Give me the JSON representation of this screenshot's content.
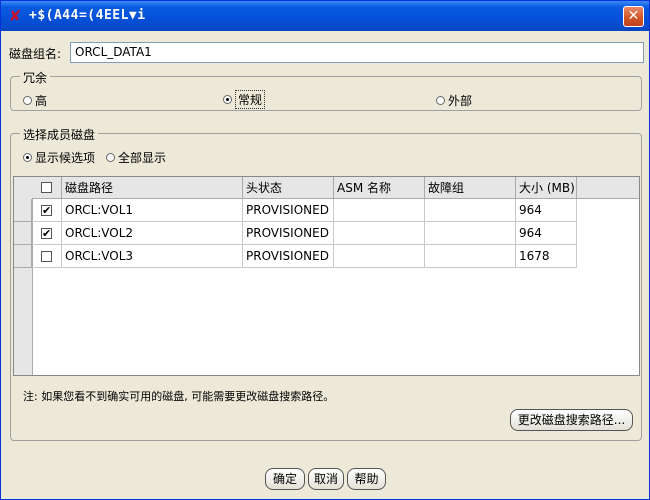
{
  "window": {
    "title": "+$(A44=(4EEL▼i",
    "title_icon": "✘",
    "close_glyph": "✕"
  },
  "diskgroup": {
    "name_label": "磁盘组名:",
    "name_value": "ORCL_DATA1"
  },
  "redundancy": {
    "title": "冗余",
    "options": [
      "高",
      "常规",
      "外部"
    ],
    "selected": "常规"
  },
  "members": {
    "title": "选择成员磁盘",
    "filter_options": [
      "显示候选项",
      "全部显示"
    ],
    "filter_selected": "显示候选项",
    "columns": [
      "磁盘路径",
      "头状态",
      "ASM 名称",
      "故障组",
      "大小 (MB)"
    ],
    "rows": [
      {
        "checked": true,
        "path": "ORCL:VOL1",
        "header_status": "PROVISIONED",
        "asm_name": "",
        "failgroup": "",
        "size": "964"
      },
      {
        "checked": true,
        "path": "ORCL:VOL2",
        "header_status": "PROVISIONED",
        "asm_name": "",
        "failgroup": "",
        "size": "964"
      },
      {
        "checked": false,
        "path": "ORCL:VOL3",
        "header_status": "PROVISIONED",
        "asm_name": "",
        "failgroup": "",
        "size": "1678"
      }
    ],
    "note": "注: 如果您看不到确实可用的磁盘, 可能需要更改磁盘搜索路径。",
    "change_path_button": "更改磁盘搜索路径..."
  },
  "buttons": {
    "ok": "确定",
    "cancel": "取消",
    "help": "帮助"
  },
  "check_glyph": "✔"
}
